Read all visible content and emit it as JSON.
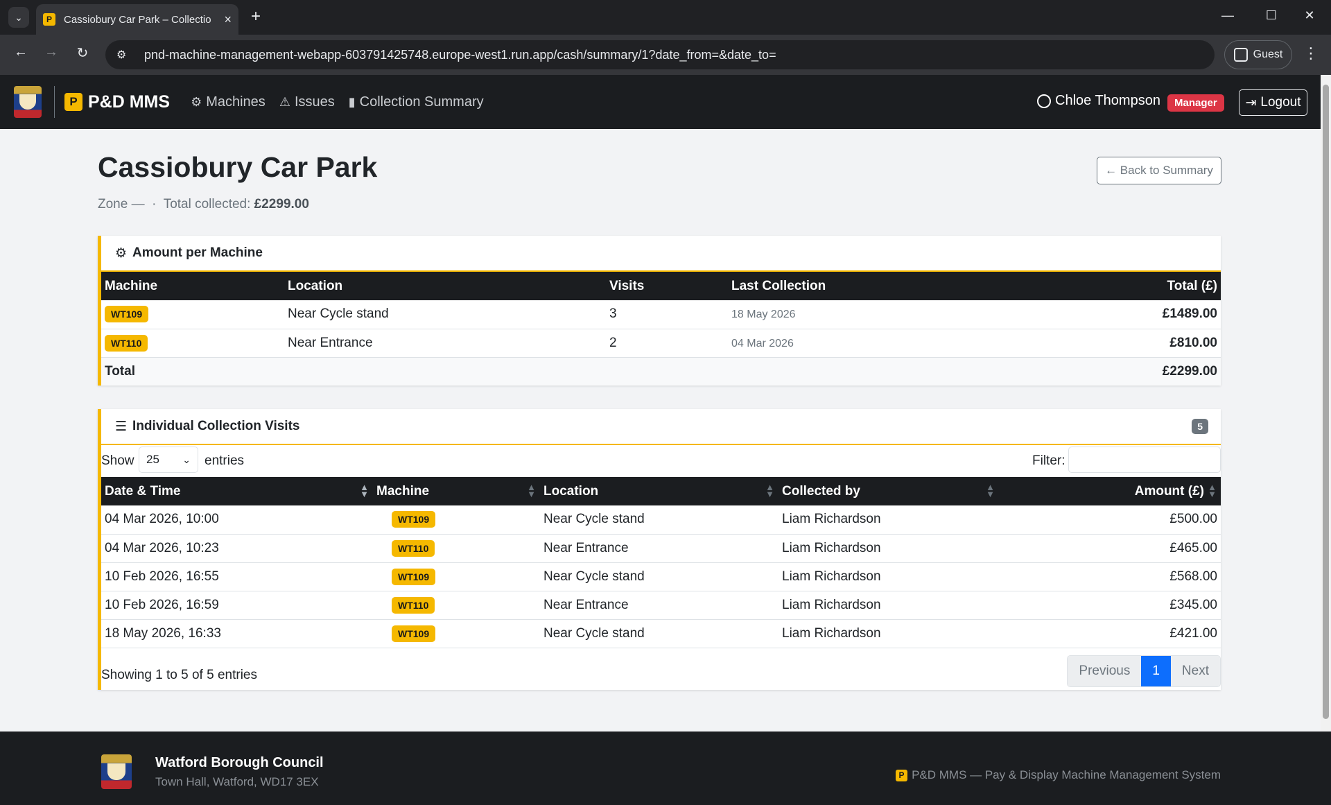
{
  "browser": {
    "tab_title": "Cassiobury Car Park – Collection",
    "tab_favicon": "P",
    "url": "pnd-machine-management-webapp-603791425748.europe-west1.run.app/cash/summary/1?date_from=&date_to=",
    "profile_label": "Guest"
  },
  "navbar": {
    "brand_badge": "P",
    "brand": "P&D MMS",
    "links": [
      {
        "label": "Machines",
        "icon": "cpu-icon"
      },
      {
        "label": "Issues",
        "icon": "warning-triangle-icon"
      },
      {
        "label": "Collection Summary",
        "icon": "bar-chart-icon"
      }
    ],
    "user_name": "Chloe Thompson",
    "user_role": "Manager",
    "logout_label": "Logout"
  },
  "page": {
    "title": "Cassiobury Car Park",
    "zone_text": "Zone —",
    "separator": "·",
    "total_label": "Total collected:",
    "total_value": "£2299.00",
    "back_label": "← Back to Summary"
  },
  "machines_card": {
    "title": "Amount per Machine",
    "columns": [
      "Machine",
      "Location",
      "Visits",
      "Last Collection",
      "Total (£)"
    ],
    "rows": [
      {
        "machine": "WT109",
        "location": "Near Cycle stand",
        "visits": "3",
        "last": "18 May 2026",
        "total": "£1489.00"
      },
      {
        "machine": "WT110",
        "location": "Near Entrance",
        "visits": "2",
        "last": "04 Mar 2026",
        "total": "£810.00"
      }
    ],
    "total_label": "Total",
    "total_value": "£2299.00"
  },
  "visits_card": {
    "title": "Individual Collection Visits",
    "count": "5",
    "show_label": "Show",
    "page_length": "25",
    "entries_label": "entries",
    "filter_label": "Filter:",
    "columns": [
      "Date & Time",
      "Machine",
      "Location",
      "Collected by",
      "Amount (£)"
    ],
    "rows": [
      {
        "datetime": "04 Mar 2026, 10:00",
        "machine": "WT109",
        "location": "Near Cycle stand",
        "collector": "Liam Richardson",
        "amount": "£500.00"
      },
      {
        "datetime": "04 Mar 2026, 10:23",
        "machine": "WT110",
        "location": "Near Entrance",
        "collector": "Liam Richardson",
        "amount": "£465.00"
      },
      {
        "datetime": "10 Feb 2026, 16:55",
        "machine": "WT109",
        "location": "Near Cycle stand",
        "collector": "Liam Richardson",
        "amount": "£568.00"
      },
      {
        "datetime": "10 Feb 2026, 16:59",
        "machine": "WT110",
        "location": "Near Entrance",
        "collector": "Liam Richardson",
        "amount": "£345.00"
      },
      {
        "datetime": "18 May 2026, 16:33",
        "machine": "WT109",
        "location": "Near Cycle stand",
        "collector": "Liam Richardson",
        "amount": "£421.00"
      }
    ],
    "showing_text": "Showing 1 to 5 of 5 entries",
    "pager": {
      "previous": "Previous",
      "current": "1",
      "next": "Next"
    }
  },
  "footer": {
    "org_name": "Watford Borough Council",
    "address": "Town Hall, Watford, WD17 3EX",
    "badge": "P",
    "tagline": "P&D MMS — Pay & Display Machine Management System"
  },
  "colors": {
    "accent": "#f5b800",
    "dark": "#1b1d20",
    "danger": "#dc3545",
    "primary": "#0d6efd"
  }
}
